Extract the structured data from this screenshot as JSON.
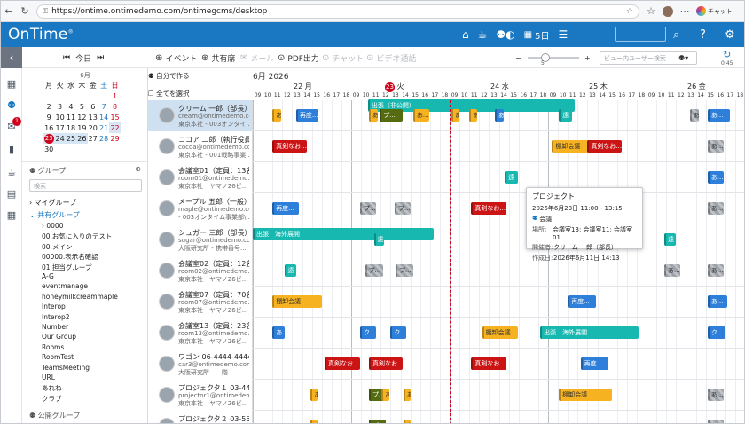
{
  "browser": {
    "url": "https://ontime.ontimedemo.com/ontimegcms/desktop",
    "chat_label": "チャット"
  },
  "app": {
    "logo": "OnTime",
    "days_label": "5日"
  },
  "search": {
    "placeholder": "",
    "ui_search_placeholder": "ビュー内ユーザー検索"
  },
  "toolbar": {
    "today": "今日",
    "event": "イベント",
    "share": "共有席",
    "mail": "メール",
    "pdf": "PDF出力",
    "chat": "チャット",
    "video": "ビデオ通話",
    "slider_value": "5",
    "refresh_time": "0:45",
    "slider_fraction": 0.35
  },
  "mini_cal": {
    "month": "6月",
    "weekdays": [
      "月",
      "火",
      "水",
      "木",
      "金",
      "土",
      "日"
    ],
    "weeks": [
      [
        "",
        "",
        "",
        "",
        "",
        "",
        "1"
      ],
      [
        "2",
        "3",
        "4",
        "5",
        "6",
        "7",
        "8"
      ],
      [
        "9",
        "10",
        "11",
        "12",
        "13",
        "14",
        "15"
      ],
      [
        "16",
        "17",
        "18",
        "19",
        "20",
        "21",
        "22"
      ],
      [
        "23",
        "24",
        "25",
        "26",
        "27",
        "28",
        "29"
      ],
      [
        "30",
        "",
        "",
        "",
        "",
        "",
        ""
      ]
    ]
  },
  "groups": {
    "title": "グループ",
    "search_placeholder": "検索",
    "my_group": "マイグループ",
    "shared_group": "共有グループ",
    "items": [
      "0000",
      "00.お気に入りのテスト",
      "00.メイン",
      "00000.表示名確認",
      "01.担当グループ",
      "A-G",
      "eventmanage",
      "honeymilkcreammaple",
      "Interop",
      "Interop2",
      "Number",
      "Our Group",
      "Rooms",
      "RoomTest",
      "TeamsMeeting",
      "URL",
      "あれね",
      "クラブ"
    ],
    "public_group": "公開グループ"
  },
  "grid": {
    "create_label": "自分で作る",
    "select_all": "全てを選択",
    "month_label": "6月 2026",
    "days": [
      {
        "label": "22 月",
        "today": false
      },
      {
        "label": "23 火",
        "today": true
      },
      {
        "label": "24 水",
        "today": false
      },
      {
        "label": "25 木",
        "today": false
      },
      {
        "label": "26 金",
        "today": false
      }
    ],
    "hours": [
      "09",
      "10",
      "11",
      "12",
      "13",
      "14",
      "15",
      "16",
      "17",
      "18"
    ]
  },
  "rows": [
    {
      "name": "クリーム 一郎（部長）",
      "sub1": "cream@ontimedemo.co...",
      "sub2": "東京本社 - 003オンタイ..."
    },
    {
      "name": "ココア 二郎（執行役員）",
      "sub1": "cocoa@ontimedemo.co...",
      "sub2": "東京本社 - 001戦略事業..."
    },
    {
      "name": "会議室01（定員：13名）0...",
      "sub1": "room01@ontimedemo.c...",
      "sub2": "東京本社　ヤマノ26ビ..."
    },
    {
      "name": "メープル 五郎（一般）",
      "sub1": "maple@ontimedemo.co...",
      "sub2": "- 003オンタイム事業部\\..."
    },
    {
      "name": "シュガー 三郎（部長）",
      "sub1": "sugar@ontimedemo.co...",
      "sub2": "大阪研究所 - 携帯番号..."
    },
    {
      "name": "会議室02（定員：12名）0...",
      "sub1": "room02@ontimedemo.c...",
      "sub2": "東京本社　ヤマノ26ビ..."
    },
    {
      "name": "会議室07（定員：70名）",
      "sub1": "room07@ontimedemo.c...",
      "sub2": "東京本社　ヤマノ26ビ..."
    },
    {
      "name": "会議室13（定員：23名）",
      "sub1": "room13@ontimedemo.c...",
      "sub2": "東京本社　ヤマノ26ビ..."
    },
    {
      "name": "ワゴン 06-4444-4444（...",
      "sub1": "car3@ontimedemo.com",
      "sub2": "大阪研究所　　階"
    },
    {
      "name": "プロジェクタ１ 03-4444...",
      "sub1": "projector1@ontimedem...",
      "sub2": "東京本社　ヤマノ26ビ..."
    },
    {
      "name": "プロジェクタ２ 03-5555...",
      "sub1": "",
      "sub2": ""
    }
  ],
  "events": {
    "dekake": "出張（非公開）",
    "kaigi": "棚卸会議",
    "shinken": "真剣なお...",
    "saido": "再度...",
    "ku": "ク...",
    "puro": "プ...",
    "en": "遠",
    "a": "あ...",
    "ryoku": "出張　海外展開"
  },
  "popup": {
    "title": "プロジェクト",
    "datetime": "2026年6月23日 11:00 - 13:15",
    "type": "会議",
    "place_k": "場所:",
    "place_v": "会議室13; 会議室11; 会議室01",
    "host_k": "開催者:",
    "host_v": "クリーム 一郎（部長）",
    "created_k": "作成日:",
    "created_v": "2026年6月11日 14:13"
  }
}
